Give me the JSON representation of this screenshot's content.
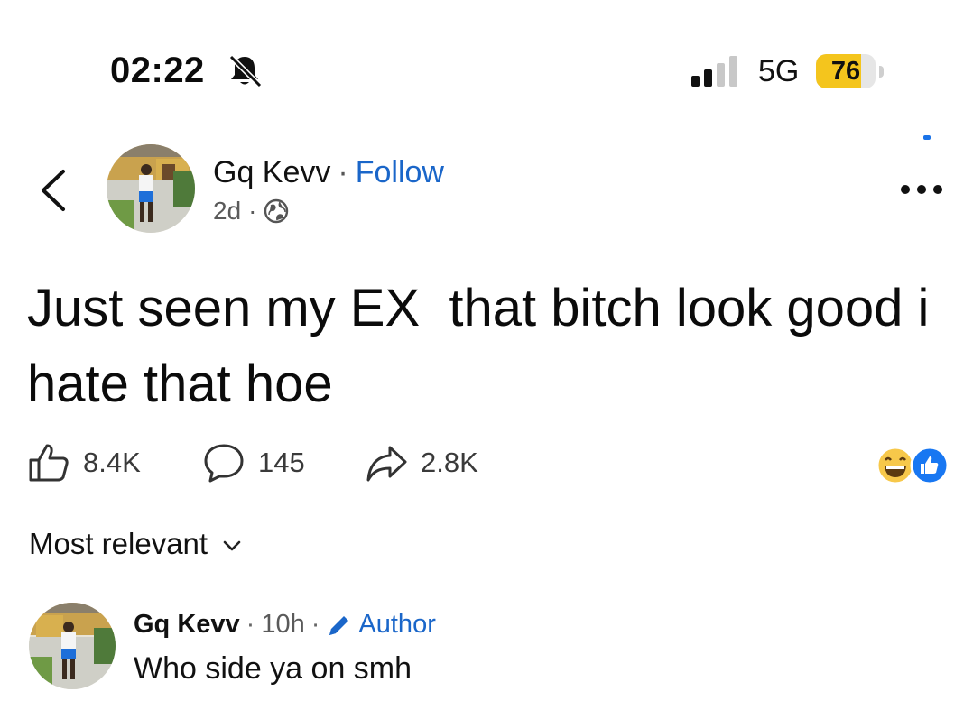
{
  "status_bar": {
    "time": "02:22",
    "network": "5G",
    "battery": "76",
    "battery_fraction": 0.76,
    "icons": [
      "bell-slash-icon",
      "signal-icon"
    ]
  },
  "post": {
    "author": "Gq Kevv",
    "separator": "·",
    "follow_label": "Follow",
    "age": "2d",
    "audience_icon": "globe-icon",
    "text": "Just seen my EX  that bitch look good i hate that hoe",
    "likes": "8.4K",
    "comments": "145",
    "shares": "2.8K",
    "reaction_icons": [
      "laughing-face-icon",
      "like-icon"
    ]
  },
  "comments_section": {
    "sort_label": "Most relevant"
  },
  "comment": {
    "author": "Gq Kevv",
    "time": "10h",
    "badge": "Author",
    "text": "Who side ya on smh"
  },
  "colors": {
    "accent": "#1a66c9",
    "battery": "#f4c51d",
    "text": "#0b0b0b",
    "muted": "#5a5a5a"
  }
}
